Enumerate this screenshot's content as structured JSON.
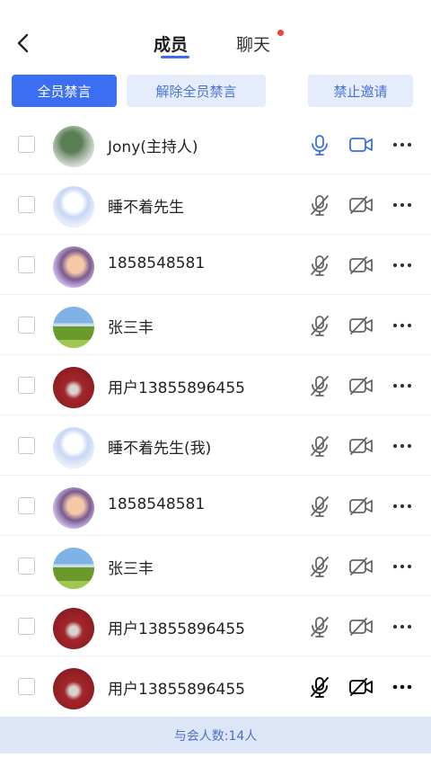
{
  "header": {
    "tabs": [
      {
        "label": "成员",
        "active": true
      },
      {
        "label": "聊天",
        "active": false,
        "has_unread_dot": true
      }
    ],
    "back_icon": "chevron-left-icon"
  },
  "actions": {
    "mute_all": "全员禁言",
    "unmute_all": "解除全员禁言",
    "disable_invite": "禁止邀请"
  },
  "members": [
    {
      "name": "Jony(主持人)",
      "mic": "on",
      "camera": "on"
    },
    {
      "name": "睡不着先生",
      "mic": "off",
      "camera": "off"
    },
    {
      "name": "1858548581",
      "mic": "off",
      "camera": "off"
    },
    {
      "name": "张三丰",
      "mic": "off",
      "camera": "off"
    },
    {
      "name": "用户13855896455",
      "mic": "off",
      "camera": "off"
    },
    {
      "name": "睡不着先生(我)",
      "mic": "off",
      "camera": "off"
    },
    {
      "name": "1858548581",
      "mic": "off",
      "camera": "off"
    },
    {
      "name": "张三丰",
      "mic": "off",
      "camera": "off"
    },
    {
      "name": "用户13855896455",
      "mic": "off",
      "camera": "off"
    },
    {
      "name": "用户13855896455",
      "mic": "off",
      "camera": "off"
    }
  ],
  "footer": {
    "count_text": "与会人数:14人"
  },
  "colors": {
    "accent": "#3b6ef2",
    "light_button_bg": "#e5ecfb",
    "footer_bg": "#dde6f7",
    "unread_dot": "#f2413c"
  }
}
